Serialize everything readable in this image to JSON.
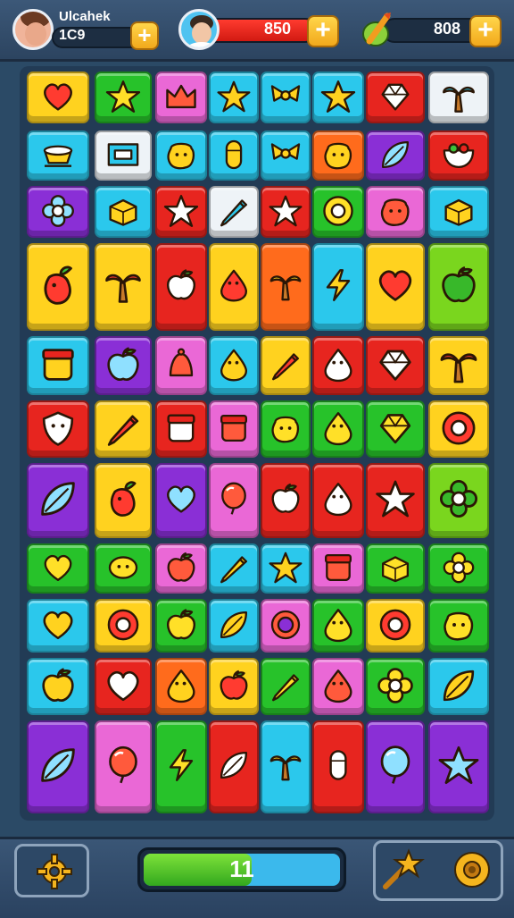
{
  "hud": {
    "player_name": "Ulcahek",
    "player_score": "1C9",
    "coins": "850",
    "gems": "808",
    "plus_symbol": "+"
  },
  "colors": {
    "yellow": "#ffd21f",
    "green": "#27c22a",
    "pink": "#ea68d6",
    "cyan": "#2bc8ec",
    "red": "#e7251f",
    "orange": "#ff6b1c",
    "purple": "#8a2fd6",
    "white": "#eef3f7",
    "lime": "#7ad61e"
  },
  "board": {
    "columns": 8,
    "rows": [
      [
        {
          "c": "yellow",
          "i": "heart"
        },
        {
          "c": "green",
          "i": "star"
        },
        {
          "c": "pink",
          "i": "crown"
        },
        {
          "c": "cyan",
          "i": "star"
        },
        {
          "c": "cyan",
          "i": "bow"
        },
        {
          "c": "cyan",
          "i": "star"
        },
        {
          "c": "red",
          "i": "gem"
        },
        {
          "c": "white",
          "i": "palm"
        }
      ],
      [
        {
          "c": "cyan",
          "i": "cup"
        },
        {
          "c": "white",
          "i": "flag"
        },
        {
          "c": "cyan",
          "i": "blob"
        },
        {
          "c": "cyan",
          "i": "candy"
        },
        {
          "c": "cyan",
          "i": "bow"
        },
        {
          "c": "orange",
          "i": "blob"
        },
        {
          "c": "purple",
          "i": "leaf"
        },
        {
          "c": "red",
          "i": "bowl"
        }
      ],
      [
        {
          "c": "purple",
          "i": "flower"
        },
        {
          "c": "cyan",
          "i": "cube"
        },
        {
          "c": "red",
          "i": "star"
        },
        {
          "c": "white",
          "i": "pencil"
        },
        {
          "c": "red",
          "i": "star"
        },
        {
          "c": "green",
          "i": "ball"
        },
        {
          "c": "pink",
          "i": "blob"
        },
        {
          "c": "cyan",
          "i": "cube"
        }
      ],
      [
        {
          "c": "yellow",
          "i": "carrot"
        },
        {
          "c": "yellow",
          "i": "palm"
        },
        {
          "c": "red",
          "i": "apple"
        },
        {
          "c": "yellow",
          "i": "drop"
        },
        {
          "c": "orange",
          "i": "palm"
        },
        {
          "c": "cyan",
          "i": "bolt"
        },
        {
          "c": "yellow",
          "i": "heart"
        },
        {
          "c": "lime",
          "i": "apple"
        }
      ],
      [
        {
          "c": "cyan",
          "i": "jar"
        },
        {
          "c": "purple",
          "i": "apple"
        },
        {
          "c": "pink",
          "i": "bell"
        },
        {
          "c": "cyan",
          "i": "drop"
        },
        {
          "c": "yellow",
          "i": "pencil"
        },
        {
          "c": "red",
          "i": "drop"
        },
        {
          "c": "red",
          "i": "gem"
        },
        {
          "c": "yellow",
          "i": "palm"
        }
      ],
      [
        {
          "c": "red",
          "i": "shield"
        },
        {
          "c": "yellow",
          "i": "pencil"
        },
        {
          "c": "red",
          "i": "jar"
        },
        {
          "c": "pink",
          "i": "jar"
        },
        {
          "c": "green",
          "i": "blob"
        },
        {
          "c": "green",
          "i": "drop"
        },
        {
          "c": "green",
          "i": "gem"
        },
        {
          "c": "yellow",
          "i": "ball"
        }
      ],
      [
        {
          "c": "purple",
          "i": "leaf"
        },
        {
          "c": "yellow",
          "i": "carrot"
        },
        {
          "c": "purple",
          "i": "heart"
        },
        {
          "c": "pink",
          "i": "balloon"
        },
        {
          "c": "red",
          "i": "apple"
        },
        {
          "c": "red",
          "i": "drop"
        },
        {
          "c": "red",
          "i": "star"
        },
        {
          "c": "lime",
          "i": "flower"
        }
      ],
      [
        {
          "c": "green",
          "i": "heart"
        },
        {
          "c": "green",
          "i": "lemon"
        },
        {
          "c": "pink",
          "i": "apple"
        },
        {
          "c": "cyan",
          "i": "pencil"
        },
        {
          "c": "cyan",
          "i": "star"
        },
        {
          "c": "pink",
          "i": "jar"
        },
        {
          "c": "green",
          "i": "cube"
        },
        {
          "c": "green",
          "i": "flower"
        }
      ],
      [
        {
          "c": "cyan",
          "i": "heart"
        },
        {
          "c": "yellow",
          "i": "ball"
        },
        {
          "c": "green",
          "i": "apple"
        },
        {
          "c": "cyan",
          "i": "leaf"
        },
        {
          "c": "pink",
          "i": "ring"
        },
        {
          "c": "green",
          "i": "drop"
        },
        {
          "c": "yellow",
          "i": "ball"
        },
        {
          "c": "green",
          "i": "blob"
        }
      ],
      [
        {
          "c": "cyan",
          "i": "apple"
        },
        {
          "c": "red",
          "i": "heart"
        },
        {
          "c": "orange",
          "i": "drop"
        },
        {
          "c": "yellow",
          "i": "apple"
        },
        {
          "c": "green",
          "i": "pencil"
        },
        {
          "c": "pink",
          "i": "drop"
        },
        {
          "c": "green",
          "i": "flower"
        },
        {
          "c": "cyan",
          "i": "leaf"
        }
      ],
      [
        {
          "c": "purple",
          "i": "leaf"
        },
        {
          "c": "pink",
          "i": "balloon"
        },
        {
          "c": "green",
          "i": "bolt"
        },
        {
          "c": "red",
          "i": "leaf"
        },
        {
          "c": "cyan",
          "i": "palm"
        },
        {
          "c": "red",
          "i": "candy"
        },
        {
          "c": "purple",
          "i": "balloon"
        },
        {
          "c": "purple",
          "i": "star"
        }
      ]
    ]
  },
  "footer": {
    "progress_label": "11",
    "progress_fraction": 0.55
  }
}
